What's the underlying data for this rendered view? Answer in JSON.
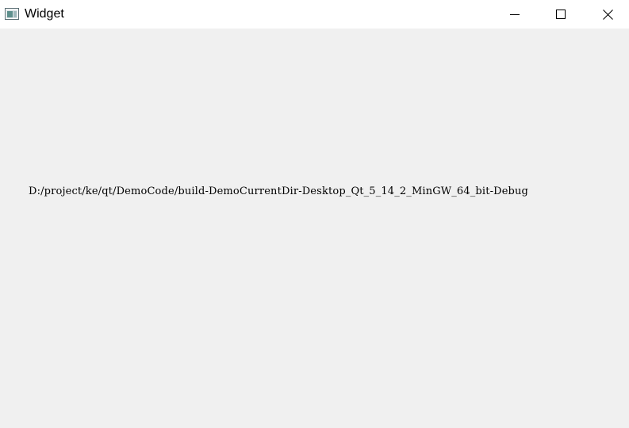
{
  "window": {
    "title": "Widget",
    "icon": "qt-widget-app-icon"
  },
  "titlebar_buttons": {
    "minimize_icon": "minimize-icon",
    "maximize_icon": "maximize-icon",
    "close_icon": "close-icon"
  },
  "content": {
    "path_text": "D:/project/ke/qt/DemoCode/build-DemoCurrentDir-Desktop_Qt_5_14_2_MinGW_64_bit-Debug"
  },
  "colors": {
    "titlebar_bg": "#ffffff",
    "client_bg": "#f0f0f0",
    "text": "#000000"
  }
}
